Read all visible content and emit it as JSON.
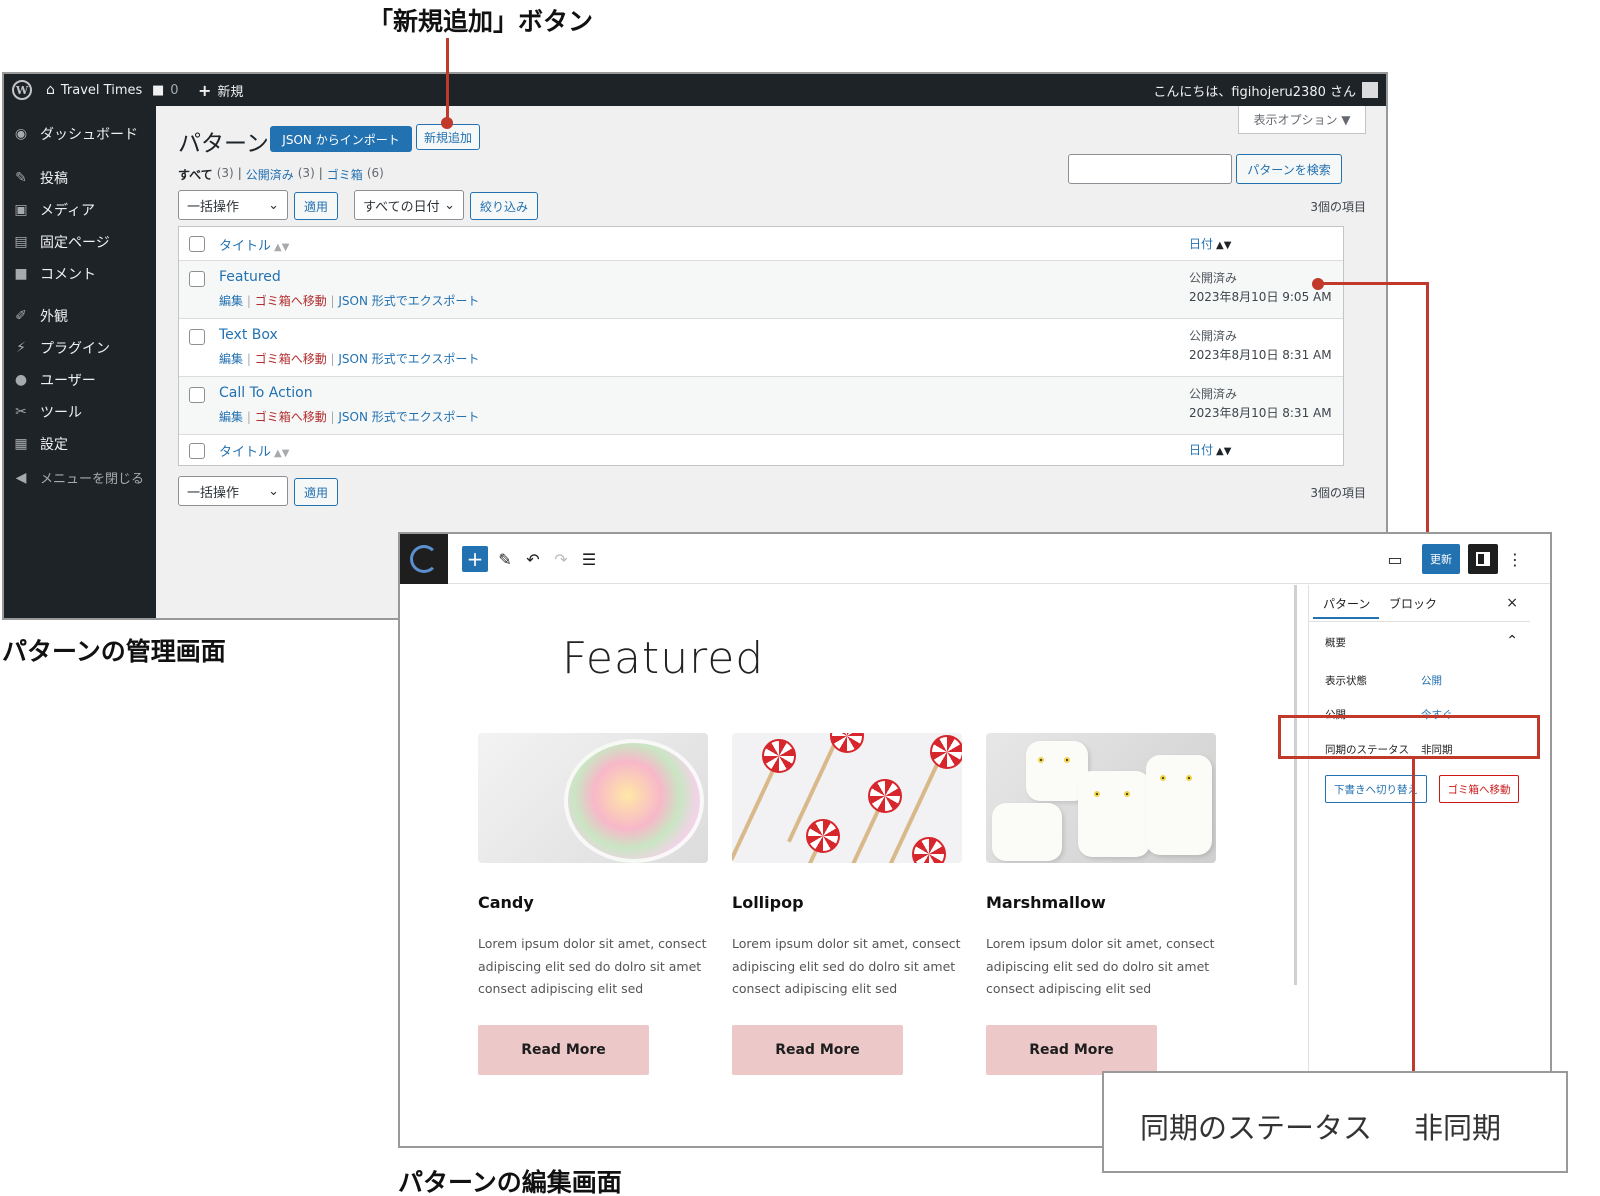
{
  "captions": {
    "new_button": "「新規追加」ボタン",
    "admin_screen": "パターンの管理画面",
    "editor_screen": "パターンの編集画面"
  },
  "admin": {
    "adminbar": {
      "site_name": "Travel Times",
      "comments_count": "0",
      "new_label": "新規",
      "greeting": "こんにちは、figihojeru2380 さん"
    },
    "sidebar": {
      "items": [
        {
          "label": "ダッシュボード",
          "icon": "dashboard-icon"
        },
        {
          "label": "投稿",
          "icon": "pin-icon"
        },
        {
          "label": "メディア",
          "icon": "media-icon"
        },
        {
          "label": "固定ページ",
          "icon": "page-icon"
        },
        {
          "label": "コメント",
          "icon": "comment-icon"
        },
        {
          "label": "外観",
          "icon": "brush-icon"
        },
        {
          "label": "プラグイン",
          "icon": "plugin-icon"
        },
        {
          "label": "ユーザー",
          "icon": "user-icon"
        },
        {
          "label": "ツール",
          "icon": "wrench-icon"
        },
        {
          "label": "設定",
          "icon": "settings-icon"
        },
        {
          "label": "メニューを閉じる",
          "icon": "collapse-icon"
        }
      ]
    },
    "screen_options": "表示オプション ▼",
    "heading": "パターン",
    "import_button": "JSON からインポート",
    "add_new_button": "新規追加",
    "filters": {
      "all": "すべて",
      "all_count": "(3)",
      "published": "公開済み",
      "published_count": "(3)",
      "trash": "ゴミ箱",
      "trash_count": "(6)",
      "sep": "|"
    },
    "search_button": "パターンを検索",
    "bulk_action": "一括操作",
    "apply": "適用",
    "all_dates": "すべての日付",
    "filter_button": "絞り込み",
    "items_count": "3個の項目",
    "table": {
      "col_title": "タイトル",
      "col_date": "日付",
      "rows": [
        {
          "title": "Featured",
          "status": "公開済み",
          "date": "2023年8月10日 9:05 AM"
        },
        {
          "title": "Text Box",
          "status": "公開済み",
          "date": "2023年8月10日 8:31 AM"
        },
        {
          "title": "Call To Action",
          "status": "公開済み",
          "date": "2023年8月10日 8:31 AM"
        }
      ],
      "action_edit": "編集",
      "action_trash": "ゴミ箱へ移動",
      "action_export": "JSON 形式でエクスポート",
      "action_sep": " | "
    }
  },
  "editor": {
    "update_button": "更新",
    "title": "Featured",
    "cards": [
      {
        "title": "Candy",
        "text": "Lorem ipsum dolor sit amet, consect adipiscing elit sed do dolro sit amet consect adipiscing elit sed",
        "button": "Read More"
      },
      {
        "title": "Lollipop",
        "text": "Lorem ipsum dolor sit amet, consect adipiscing elit sed do dolro sit amet consect adipiscing elit sed",
        "button": "Read More"
      },
      {
        "title": "Marshmallow",
        "text": "Lorem ipsum dolor sit amet, consect adipiscing elit sed do dolro sit amet consect adipiscing elit sed",
        "button": "Read More"
      }
    ],
    "sidebar": {
      "tab_pattern": "パターン",
      "tab_block": "ブロック",
      "close": "×",
      "summary": "概要",
      "visibility_label": "表示状態",
      "visibility_value": "公開",
      "publish_label": "公開",
      "publish_value": "今すぐ",
      "sync_label": "同期のステータス",
      "sync_value": "非同期",
      "draft_button": "下書きへ切り替え",
      "trash_button": "ゴミ箱へ移動"
    }
  },
  "zoom": {
    "label": "同期のステータス",
    "value": "非同期"
  },
  "colors": {
    "accent": "#2271b1",
    "annotation_red": "#c0392b",
    "adminbar": "#1d2327",
    "read_more_bg": "#ecc8c8"
  }
}
